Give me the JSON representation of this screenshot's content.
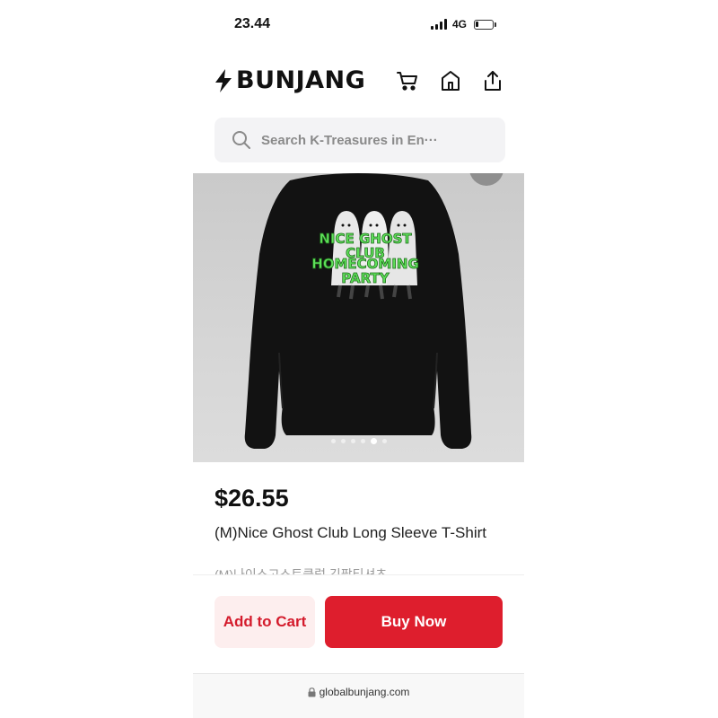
{
  "status_bar": {
    "time": "23.44",
    "network": "4G",
    "battery_level": 0.2
  },
  "header": {
    "brand": "BUNJANG",
    "icons": [
      "cart-icon",
      "home-icon",
      "share-icon"
    ]
  },
  "search": {
    "placeholder": "Search K-Treasures in En···"
  },
  "product": {
    "print_lines": [
      "NICE GHOST",
      "CLUB",
      "HOMECOMING",
      "PARTY"
    ],
    "carousel_total": 6,
    "carousel_active": 5,
    "price": "$26.55",
    "title": "(M)Nice Ghost Club Long Sleeve T-Shirt",
    "subtitle": "(M)나이스고스트클럽 긴팔티셔츠"
  },
  "actions": {
    "add_to_cart": "Add to Cart",
    "buy_now": "Buy Now"
  },
  "browser": {
    "url": "globalbunjang.com"
  },
  "colors": {
    "accent": "#de1e2d",
    "accent_light": "#fdeeee",
    "ghost_text": "#5fe05a"
  }
}
